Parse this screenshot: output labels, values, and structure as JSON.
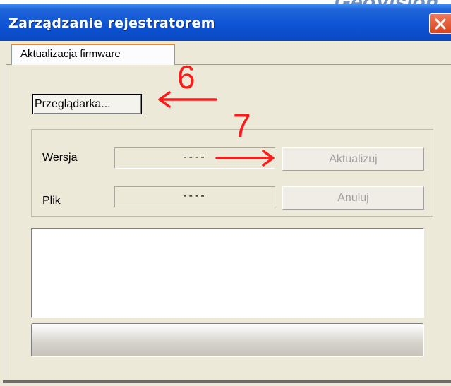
{
  "watermark": "GeoVision",
  "window": {
    "title": "Zarządzanie rejestratorem",
    "close_glyph": "✕"
  },
  "tabs": [
    {
      "label": "Aktualizacja firmware",
      "active": true
    }
  ],
  "browse_button": {
    "label": "Przeglądarka..."
  },
  "version_row": {
    "label": "Wersja",
    "value": "----",
    "button_label": "Aktualizuj",
    "button_enabled": false
  },
  "file_row": {
    "label": "Plik",
    "value": "----",
    "button_label": "Anuluj",
    "button_enabled": false
  },
  "log": {
    "lines": []
  },
  "progress": {
    "value": 0
  },
  "annotations": [
    {
      "number": "6",
      "points_to": "browse_button",
      "color": "#ff1a1a"
    },
    {
      "number": "7",
      "points_to": "version_row",
      "color": "#ff1a1a"
    }
  ],
  "colors": {
    "titlebar": "#0d54d6",
    "window_bg": "#ece9d8",
    "annotation": "#ff1a1a",
    "tab_highlight": "#e68b2c"
  }
}
